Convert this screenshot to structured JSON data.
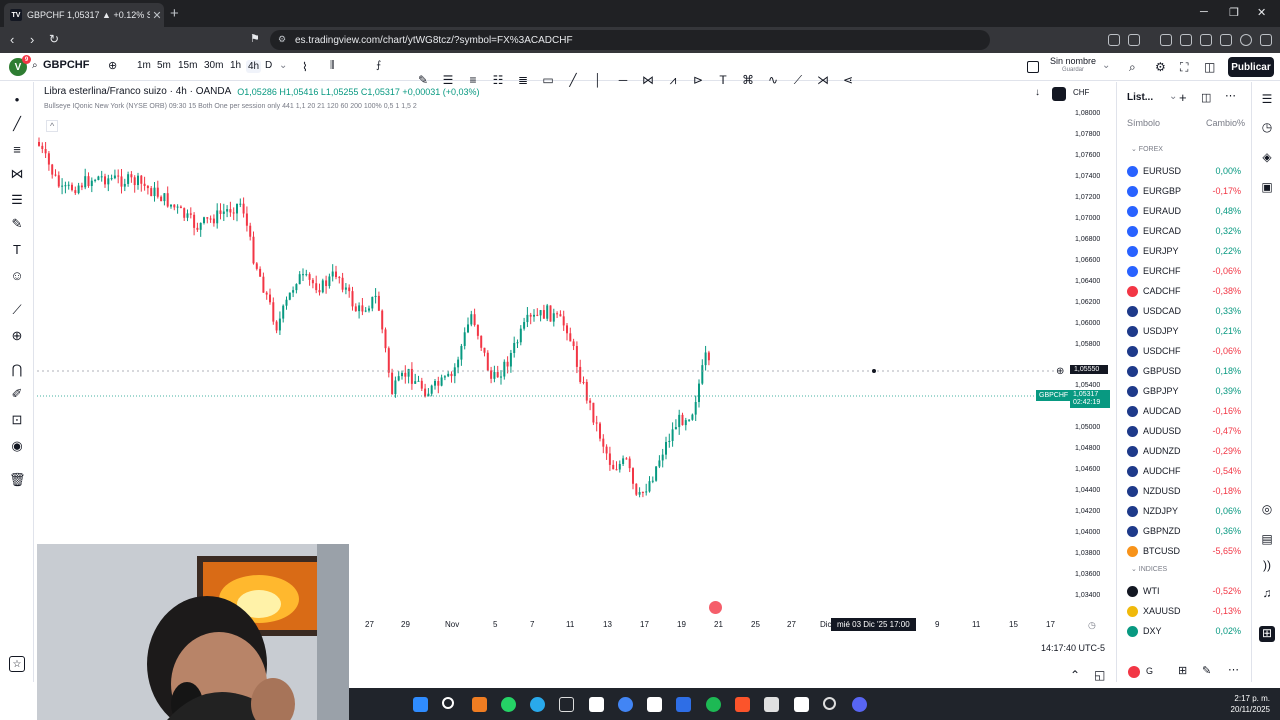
{
  "browser": {
    "tab_title": "GBPCHF 1,05317 ▲ +0.12% Sin",
    "url": "es.tradingview.com/chart/ytWG8tcz/?symbol=FX%3ACADCHF"
  },
  "header": {
    "symbol": "GBPCHF",
    "timeframes": [
      "1m",
      "5m",
      "15m",
      "30m",
      "1h",
      "4h",
      "D"
    ],
    "active_timeframe": "4h",
    "layout_name": "Sin nombre",
    "layout_sub": "Guardar",
    "publish_label": "Publicar"
  },
  "chart": {
    "title": "Libra esterlina/Franco suizo · 4h · OANDA",
    "ohlc": "O1,05286 H1,05416 L1,05255 C1,05317 +0,00031 (+0,03%)",
    "indicator": "Bullseye IQonic New York (NYSE ORB) 09:30 15 Both One per session only 441 1,1 20 21 120 60 200 100% 0,5 1 1,5 2",
    "currency": "CHF",
    "price_labels": [
      "1,08000",
      "1,07800",
      "1,07600",
      "1,07400",
      "1,07200",
      "1,07000",
      "1,06800",
      "1,06600",
      "1,06400",
      "1,06200",
      "1,06000",
      "1,05800",
      "1,05400",
      "1,05000",
      "1,04800",
      "1,04600",
      "1,04400",
      "1,04200",
      "1,04000",
      "1,03800",
      "1,03600",
      "1,03400"
    ],
    "crosshair_price": "1,05550",
    "current_symbol_tag": "GBPCHF",
    "current_price": "1,05317",
    "countdown": "02:42:19",
    "time_labels": [
      "27",
      "29",
      "Nov",
      "5",
      "7",
      "11",
      "13",
      "17",
      "19",
      "21",
      "25",
      "27",
      "Dic",
      "9",
      "11",
      "15",
      "17"
    ],
    "crosshair_time": "mié 03 Dic '25  17:00",
    "clock": "14:17:40 UTC-5"
  },
  "watchlist": {
    "title": "List...",
    "col_symbol": "Símbolo",
    "col_change": "Cambio%",
    "sections": [
      {
        "name": "FOREX",
        "items": [
          {
            "symbol": "EURUSD",
            "change": "0,00%",
            "dir": "pos",
            "color": "#2962ff"
          },
          {
            "symbol": "EURGBP",
            "change": "-0,17%",
            "dir": "neg",
            "color": "#2962ff"
          },
          {
            "symbol": "EURAUD",
            "change": "0,48%",
            "dir": "pos",
            "color": "#2962ff"
          },
          {
            "symbol": "EURCAD",
            "change": "0,32%",
            "dir": "pos",
            "color": "#2962ff"
          },
          {
            "symbol": "EURJPY",
            "change": "0,22%",
            "dir": "pos",
            "color": "#2962ff"
          },
          {
            "symbol": "EURCHF",
            "change": "-0,06%",
            "dir": "neg",
            "color": "#2962ff"
          },
          {
            "symbol": "CADCHF",
            "change": "-0,38%",
            "dir": "neg",
            "color": "#f23645"
          },
          {
            "symbol": "USDCAD",
            "change": "0,33%",
            "dir": "pos",
            "color": "#1e3a8a"
          },
          {
            "symbol": "USDJPY",
            "change": "0,21%",
            "dir": "pos",
            "color": "#1e3a8a"
          },
          {
            "symbol": "USDCHF",
            "change": "-0,06%",
            "dir": "neg",
            "color": "#1e3a8a"
          },
          {
            "symbol": "GBPUSD",
            "change": "0,18%",
            "dir": "pos",
            "color": "#1e3a8a"
          },
          {
            "symbol": "GBPJPY",
            "change": "0,39%",
            "dir": "pos",
            "color": "#1e3a8a"
          },
          {
            "symbol": "AUDCAD",
            "change": "-0,16%",
            "dir": "neg",
            "color": "#1e3a8a"
          },
          {
            "symbol": "AUDUSD",
            "change": "-0,47%",
            "dir": "neg",
            "color": "#1e3a8a"
          },
          {
            "symbol": "AUDNZD",
            "change": "-0,29%",
            "dir": "neg",
            "color": "#1e3a8a"
          },
          {
            "symbol": "AUDCHF",
            "change": "-0,54%",
            "dir": "neg",
            "color": "#1e3a8a"
          },
          {
            "symbol": "NZDUSD",
            "change": "-0,18%",
            "dir": "neg",
            "color": "#1e3a8a"
          },
          {
            "symbol": "NZDJPY",
            "change": "0,06%",
            "dir": "pos",
            "color": "#1e3a8a"
          },
          {
            "symbol": "GBPNZD",
            "change": "0,36%",
            "dir": "pos",
            "color": "#1e3a8a"
          },
          {
            "symbol": "BTCUSD",
            "change": "-5,65%",
            "dir": "neg",
            "color": "#f7931a"
          }
        ]
      },
      {
        "name": "INDICES",
        "items": [
          {
            "symbol": "WTI",
            "change": "-0,52%",
            "dir": "neg",
            "color": "#131722"
          },
          {
            "symbol": "XAUUSD",
            "change": "-0,13%",
            "dir": "neg",
            "color": "#f0b90b"
          },
          {
            "symbol": "DXY",
            "change": "0,02%",
            "dir": "pos",
            "color": "#089981"
          }
        ]
      }
    ]
  },
  "taskbar": {
    "time": "2:17 p. m.",
    "date": "20/11/2025"
  },
  "colors": {
    "up": "#089981",
    "down": "#f23645",
    "accent": "#2962ff"
  }
}
